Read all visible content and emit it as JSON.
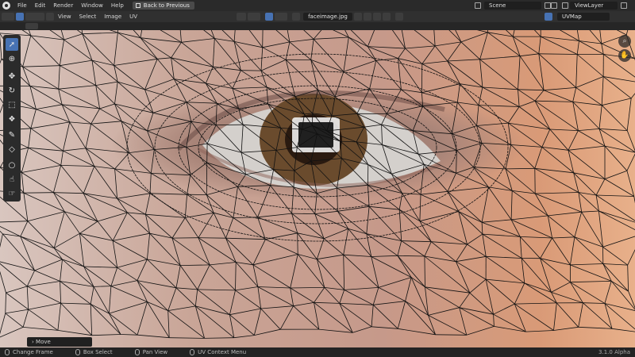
{
  "menu_bar": {
    "items": [
      "File",
      "Edit",
      "Render",
      "Window",
      "Help"
    ],
    "back_button": "Back to Previous",
    "scene": "Scene",
    "view_layer": "ViewLayer"
  },
  "editor_header": {
    "menus": [
      "View",
      "Select",
      "Image",
      "UV"
    ],
    "image_name": "faceimage.jpg",
    "uv_map": "UVMap"
  },
  "tools": [
    "select",
    "cursor",
    "move",
    "rotate",
    "scale",
    "transform",
    "annotate",
    "rip",
    "grab",
    "relax",
    "pinch"
  ],
  "operator_panel": {
    "label": "Move"
  },
  "status_bar": {
    "hints": [
      "Change Frame",
      "Box Select",
      "Pan View",
      "UV Context Menu"
    ],
    "version": "3.1.0 Alpha"
  },
  "colors": {
    "accent": "#4772b3",
    "iris": "#6a4b2d"
  }
}
